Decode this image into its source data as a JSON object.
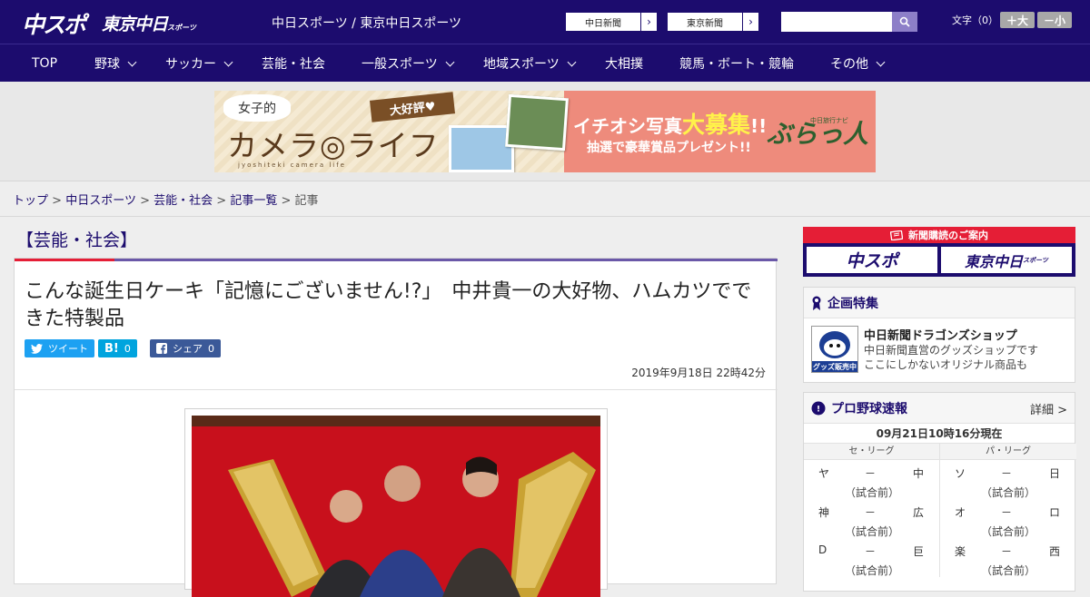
{
  "header": {
    "logo_main": "中スポ",
    "logo_tokyo": "東京中日",
    "logo_tokyo_suffix": "スポーツ",
    "site_name": "中日スポーツ / 東京中日スポーツ",
    "ext_links": [
      {
        "label": "中日新聞",
        "arrow": "›"
      },
      {
        "label": "東京新聞",
        "arrow": "›"
      }
    ],
    "search_placeholder": "",
    "font_size_label": "文字（0）",
    "font_larger": "＋大",
    "font_smaller": "－小"
  },
  "nav": [
    {
      "label": "TOP",
      "dropdown": false
    },
    {
      "label": "野球",
      "dropdown": true
    },
    {
      "label": "サッカー",
      "dropdown": true
    },
    {
      "label": "芸能・社会",
      "dropdown": false
    },
    {
      "label": "一般スポーツ",
      "dropdown": true
    },
    {
      "label": "地域スポーツ",
      "dropdown": true
    },
    {
      "label": "大相撲",
      "dropdown": false
    },
    {
      "label": "競馬・ボート・競輪",
      "dropdown": false
    },
    {
      "label": "その他",
      "dropdown": true
    }
  ],
  "banner": {
    "bubble": "女子的",
    "title": "カメラ◎ライフ",
    "subtitle": "jyoshiteki camera life",
    "tag": "大好評♥",
    "headline_pre": "イチオシ写真",
    "headline_big": "大募集",
    "headline_post": "!!",
    "present": "抽選で豪華賞品プレゼント!!",
    "brand_small": "中日旅行ナビ",
    "brand": "ぶらっ人"
  },
  "breadcrumb": {
    "items": [
      "トップ",
      "中日スポーツ",
      "芸能・社会",
      "記事一覧"
    ],
    "separator": ">",
    "current": "記事"
  },
  "category_title": "【芸能・社会】",
  "article": {
    "headline": "こんな誕生日ケーキ「記憶にございません!?」　中井貴一の大好物、ハムカツでできた特製品",
    "share": {
      "tweet": "ツイート",
      "hatena_count": "0",
      "facebook": "シェア",
      "facebook_count": "0"
    },
    "date": "2019年9月18日 22時42分"
  },
  "sidebar": {
    "subscribe_head": "新聞購読のご案内",
    "subscribe_buttons": [
      "中スポ",
      "東京中日"
    ],
    "subscribe_tokyo_suffix": "スポーツ",
    "feature": {
      "title": "企画特集",
      "item_title": "中日新聞ドラゴンズショップ",
      "item_desc_1": "中日新聞直営のグッズショップです",
      "item_desc_2": "ここにしかないオリジナル商品も",
      "thumb_label": "グッズ販売中"
    },
    "scores": {
      "title": "プロ野球速報",
      "detail": "詳細 >",
      "time": "09月21日10時16分現在",
      "central": {
        "name": "セ・リーグ",
        "games": [
          {
            "home": "ヤ",
            "away": "中",
            "score": "－",
            "status": "（試合前）"
          },
          {
            "home": "神",
            "away": "広",
            "score": "－",
            "status": "（試合前）"
          },
          {
            "home": "D",
            "away": "巨",
            "score": "－",
            "status": "（試合前）"
          }
        ]
      },
      "pacific": {
        "name": "パ・リーグ",
        "games": [
          {
            "home": "ソ",
            "away": "日",
            "score": "－",
            "status": "（試合前）"
          },
          {
            "home": "オ",
            "away": "ロ",
            "score": "－",
            "status": "（試合前）"
          },
          {
            "home": "楽",
            "away": "西",
            "score": "－",
            "status": "（試合前）"
          }
        ]
      }
    }
  },
  "colors": {
    "brand_navy": "#1c0c6e",
    "accent_red": "#e51e36",
    "accent_purple": "#6a58a8",
    "twitter": "#1da1f2",
    "hatena": "#00a4de",
    "facebook": "#3b5998"
  }
}
